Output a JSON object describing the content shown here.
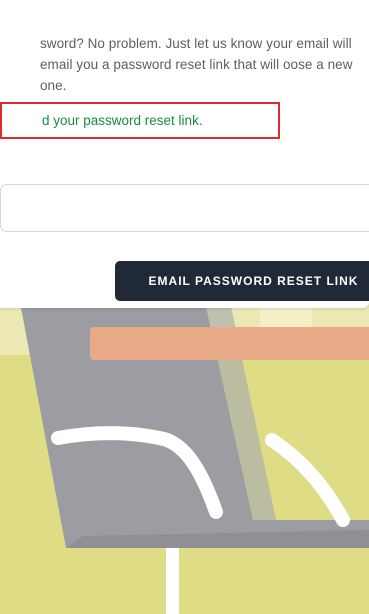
{
  "forgot_password": {
    "intro_text": "sword? No problem. Just let us know your email  will email you a password reset link that will oose a new one.",
    "status_message": "d your password reset link.",
    "email_field_value": "",
    "reset_button_label": "EMAIL PASSWORD RESET LINK"
  },
  "colors": {
    "background": "#dedc84",
    "button": "#1f2937",
    "status_text": "#168e3d",
    "status_border": "#dd2d2d"
  }
}
